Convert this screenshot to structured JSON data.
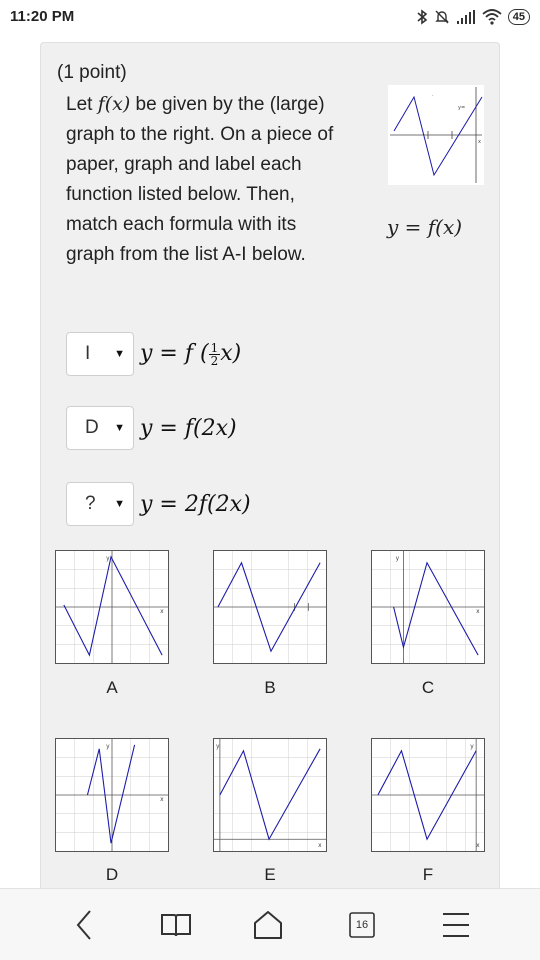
{
  "status_bar": {
    "time": "11:20 PM",
    "battery": "45"
  },
  "question": {
    "points": "(1 point)",
    "prompt_before": "Let ",
    "prompt_fx": "f(x)",
    "prompt_after": " be given by the (large) graph to the right. On a piece of paper, graph and label each function listed below. Then, match each formula with its graph from the list A-I below.",
    "main_graph_label": "y = f(x)"
  },
  "rows": [
    {
      "selected": "I",
      "formula_prefix": "y = f (",
      "frac_num": "1",
      "frac_den": "2",
      "formula_suffix": "x)"
    },
    {
      "selected": "D",
      "formula": "y = f(2x)"
    },
    {
      "selected": "?",
      "formula": "y = 2f(2x)"
    }
  ],
  "graphs": [
    {
      "label": "A",
      "icon": "graph-A"
    },
    {
      "label": "B",
      "icon": "graph-B"
    },
    {
      "label": "C",
      "icon": "graph-C"
    },
    {
      "label": "D",
      "icon": "graph-D"
    },
    {
      "label": "E",
      "icon": "graph-E"
    },
    {
      "label": "F",
      "icon": "graph-F"
    }
  ],
  "bottom_nav": {
    "tab_count": "16"
  },
  "colors": {
    "graph_line": "#1a1aa8",
    "card_bg": "#f0f0f0"
  }
}
